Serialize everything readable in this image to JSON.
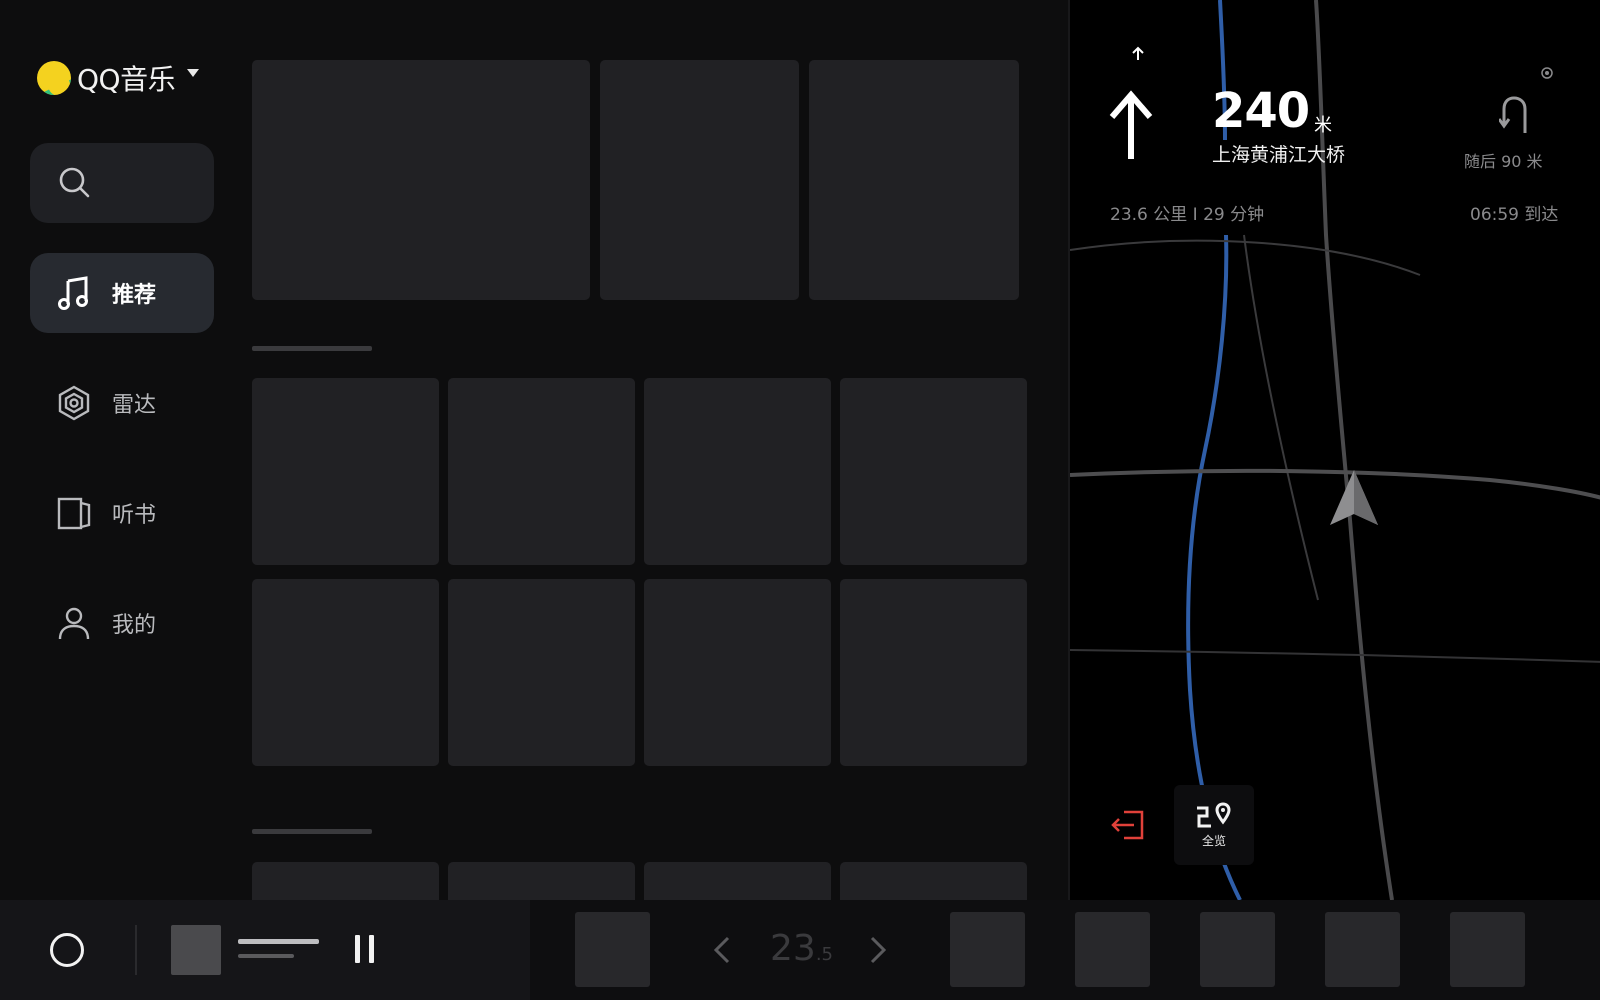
{
  "app": {
    "logo_text": "QQ音乐",
    "nav": [
      {
        "id": "recommend",
        "label": "推荐",
        "icon": "music-note-icon",
        "active": true
      },
      {
        "id": "radar",
        "label": "雷达",
        "icon": "radar-icon",
        "active": false
      },
      {
        "id": "audiobook",
        "label": "听书",
        "icon": "book-icon",
        "active": false
      },
      {
        "id": "mine",
        "label": "我的",
        "icon": "user-icon",
        "active": false
      }
    ]
  },
  "navigation": {
    "distance": "240",
    "distance_unit": "米",
    "road_name": "上海黄浦江大桥",
    "then_label": "随后 90 米",
    "trip_summary": "23.6 公里  I  29 分钟",
    "arrival": "06:59 到达",
    "overview_label": "全览"
  },
  "dock": {
    "temperature": "23",
    "temperature_decimal": ".5"
  },
  "colors": {
    "accent_route": "#2f5ea8",
    "exit_red": "#e0413a",
    "logo_yellow": "#f4d21f",
    "logo_green": "#31c27c"
  }
}
